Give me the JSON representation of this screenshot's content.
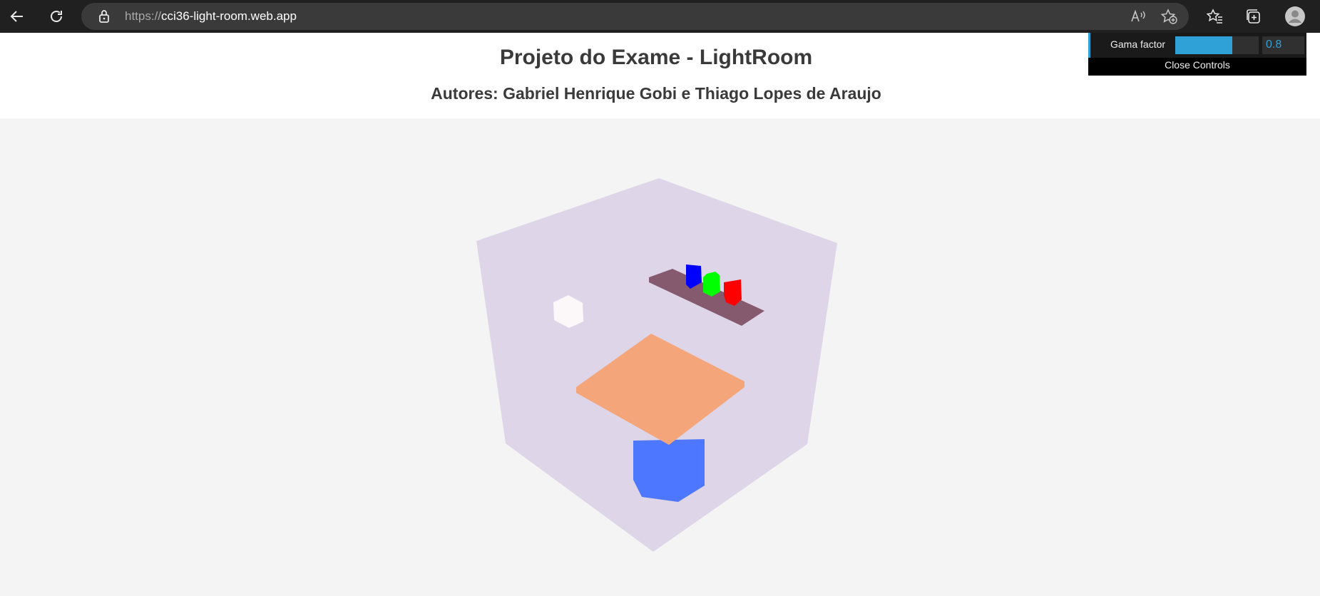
{
  "browser": {
    "url_protocol": "https://",
    "url_host": "cci36-light-room.web.app",
    "icons": [
      "back-arrow-icon",
      "refresh-icon",
      "lock-icon",
      "read-aloud-icon",
      "add-favorite-icon",
      "favorites-icon",
      "collections-icon",
      "profile-avatar-icon"
    ]
  },
  "page": {
    "title": "Projeto do Exame - LightRoom",
    "authors": "Autores: Gabriel Henrique Gobi e Thiago Lopes de Araujo"
  },
  "controls": {
    "gama_label": "Gama factor",
    "gama_value": "0.8",
    "gama_fraction": 0.68,
    "close_label": "Close Controls",
    "accent_color": "#2fa1d6"
  },
  "scene": {
    "room_color": "#ded6e8",
    "shelf_color": "#855a6e",
    "table_top_color": "#f4a57a",
    "table_base_color": "#4d77ff",
    "light_color": "#fcf8fa",
    "box_colors": [
      "#0000ff",
      "#00ff00",
      "#ff0000"
    ]
  }
}
